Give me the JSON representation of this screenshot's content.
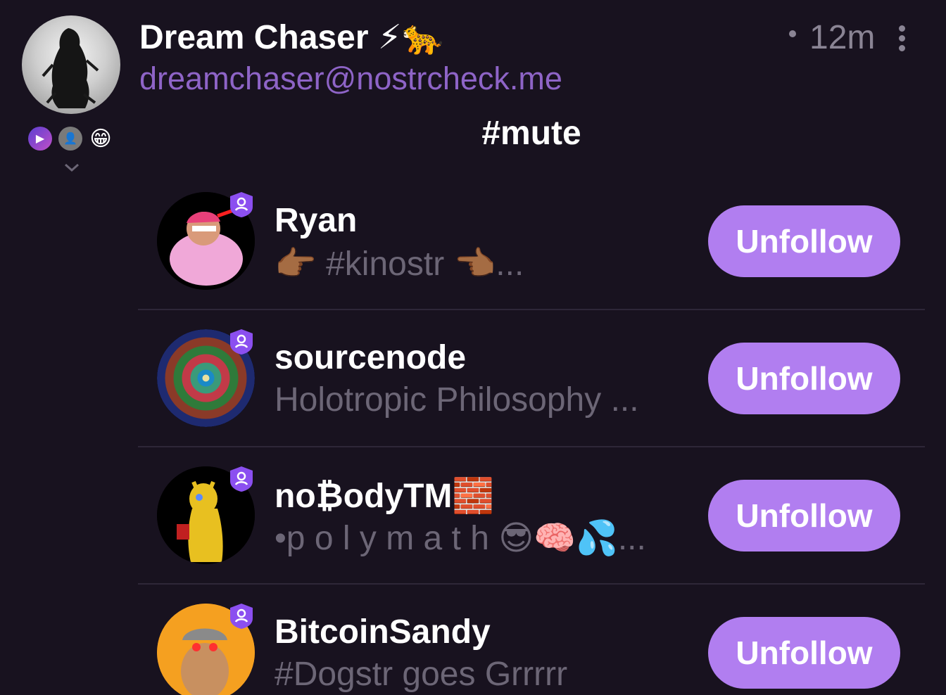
{
  "post": {
    "author_name": "Dream Chaser ⚡🐆",
    "author_nip05": "dreamchaser@nostrcheck.me",
    "time_ago": "12m",
    "content_hashtag": "#mute",
    "reactions": [
      "▶",
      "👤",
      "😁"
    ]
  },
  "follow_list": [
    {
      "name": "Ryan",
      "bio": "👉🏾 #kinostr 👈🏾...",
      "button_label": "Unfollow"
    },
    {
      "name": "sourcenode",
      "bio": "Holotropic Philosophy ...",
      "button_label": "Unfollow"
    },
    {
      "name": "no₿odyTM🧱",
      "bio": "•p o l y m a t h 😎🧠💦...",
      "button_label": "Unfollow"
    },
    {
      "name": "BitcoinSandy",
      "bio": "#Dogstr goes Grrrrr",
      "button_label": "Unfollow"
    }
  ],
  "colors": {
    "background": "#18121f",
    "accent": "#b17ef0",
    "nip05": "#8e64c7",
    "muted_text": "#6c6676",
    "verified_badge": "#8b4ff0"
  }
}
